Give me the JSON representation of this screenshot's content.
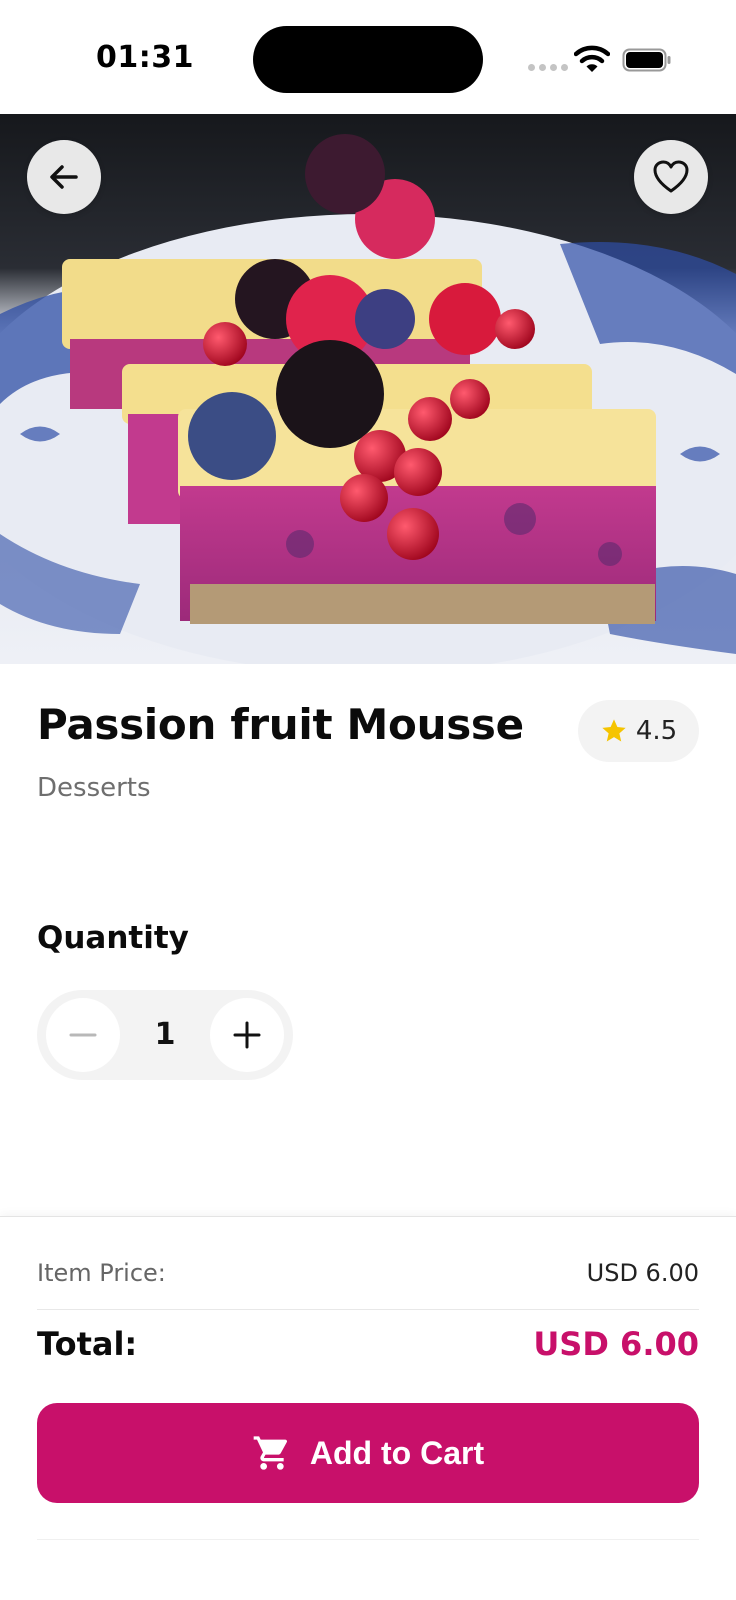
{
  "status_bar": {
    "time": "01:31",
    "icons": [
      "cellular-dots-icon",
      "wifi-icon",
      "battery-icon"
    ]
  },
  "hero": {
    "image": "berry-mousse-cake-photo",
    "back_icon": "arrow-left-icon",
    "favorite_icon": "heart-outline-icon"
  },
  "product": {
    "name": "Passion fruit Mousse",
    "category": "Desserts",
    "rating": "4.5",
    "rating_icon": "star-icon"
  },
  "quantity": {
    "label": "Quantity",
    "value": "1",
    "minus_icon": "minus-icon",
    "plus_icon": "plus-icon"
  },
  "summary": {
    "item_price_label": "Item Price:",
    "item_price_value": "USD 6.00",
    "total_label": "Total:",
    "total_value": "USD 6.00"
  },
  "cart_button": {
    "label": "Add to Cart",
    "icon": "cart-icon"
  },
  "colors": {
    "accent": "#c8106a",
    "star": "#f5c400",
    "pill_bg": "#f3f3f3"
  }
}
